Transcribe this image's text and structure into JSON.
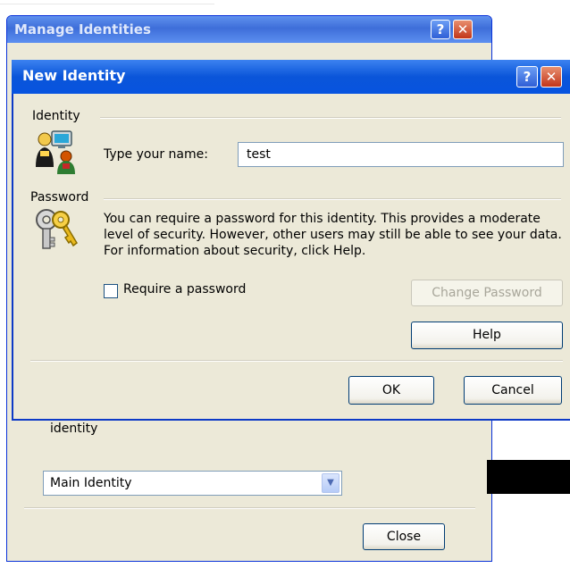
{
  "background_window": {
    "title": "Manage Identities",
    "help_glyph": "?",
    "close_glyph": "✕",
    "default_text": "Use this identity when a program cannot ask you to choose an identity",
    "default_select_value": "Main Identity",
    "close_button": "Close"
  },
  "dialog": {
    "title": "New Identity",
    "help_glyph": "?",
    "close_glyph": "✕",
    "identity_group_label": "Identity",
    "name_label": "Type your name:",
    "name_value": "test",
    "password_group_label": "Password",
    "password_description": "You can require a password for this identity.  This provides a moderate level of security. However, other users may still be able to see your data. For information about security, click Help.",
    "require_password_label": "Require a password",
    "require_password_checked": false,
    "change_password_button": "Change Password",
    "help_button": "Help",
    "ok_button": "OK",
    "cancel_button": "Cancel"
  },
  "icons": {
    "users": "users-icon",
    "keys": "keys-icon"
  }
}
